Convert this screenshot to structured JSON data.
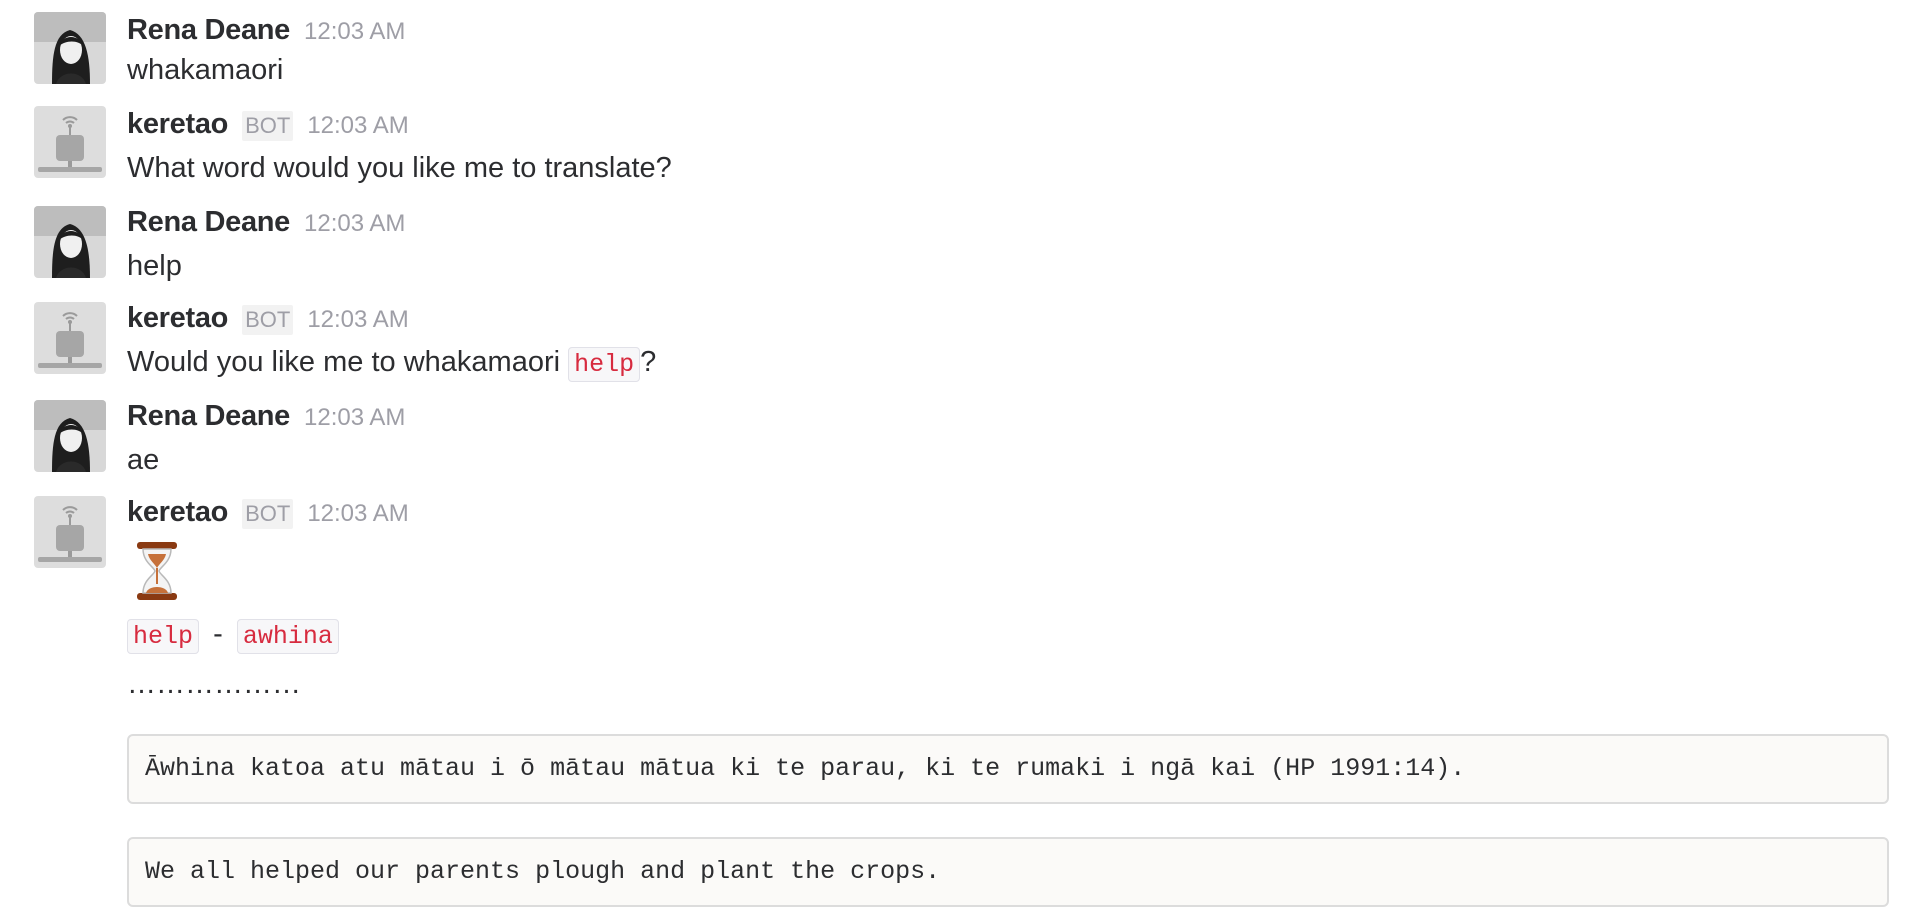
{
  "messages": [
    {
      "sender": "Rena Deane",
      "time": "12:03 AM",
      "text": "whakamaori"
    },
    {
      "sender": "keretao",
      "badge": "BOT",
      "time": "12:03 AM",
      "text": "What word would you like me to translate?"
    },
    {
      "sender": "Rena Deane",
      "time": "12:03 AM",
      "text": "help"
    },
    {
      "sender": "keretao",
      "badge": "BOT",
      "time": "12:03 AM",
      "text_before": "Would you like me to whakamaori",
      "code": "help",
      "text_after": "?"
    },
    {
      "sender": "Rena Deane",
      "time": "12:03 AM",
      "text": "ae"
    },
    {
      "sender": "keretao",
      "badge": "BOT",
      "time": "12:03 AM",
      "emoji": "hourglass-icon",
      "term": "help",
      "separator": "-",
      "translation": "awhina",
      "divider": "………………",
      "example_maori": "Āwhina katoa atu mātau i ō mātau mātua ki te parau, ki te rumaki i ngā kai (HP 1991:14).",
      "example_english": "We all helped our parents plough and plant the crops."
    }
  ],
  "colors": {
    "code_text": "#d72b3f",
    "muted": "#9e9ea6",
    "text": "#2c2d30"
  }
}
